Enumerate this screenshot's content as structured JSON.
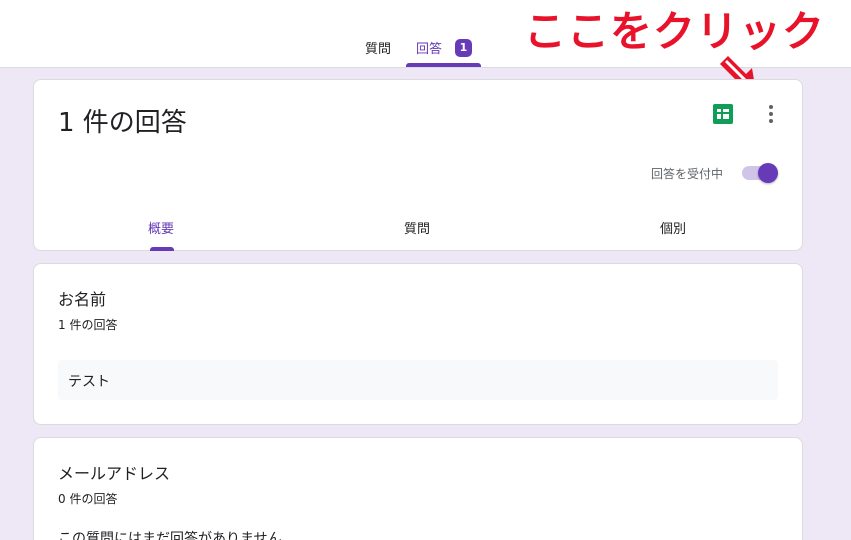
{
  "top_tabs": {
    "questions_label": "質問",
    "responses_label": "回答",
    "responses_badge": "1"
  },
  "annotation": {
    "text": "ここをクリック",
    "color": "#e8132a"
  },
  "summary": {
    "title": "1 件の回答",
    "accepting_label": "回答を受付中",
    "accepting_responses": true,
    "sheets_icon": "google-sheets-icon",
    "more_icon": "more-vert-icon",
    "subtabs": [
      "概要",
      "質問",
      "個別"
    ],
    "active_subtab": "概要"
  },
  "questions": [
    {
      "title": "お名前",
      "count": "1 件の回答",
      "answers": [
        "テスト"
      ]
    },
    {
      "title": "メールアドレス",
      "count": "0 件の回答",
      "no_answer_text": "この質問にはまだ回答がありません"
    }
  ],
  "colors": {
    "accent": "#673ab7",
    "background": "#ede7f6",
    "sheets_green": "#0f9d58"
  }
}
